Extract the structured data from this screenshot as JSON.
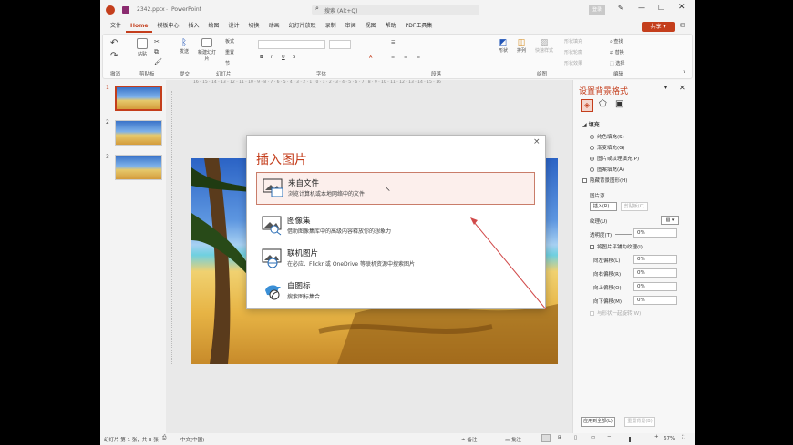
{
  "titlebar": {
    "filename": "2342.pptx",
    "app": "PowerPoint",
    "search_placeholder": "搜索 (Alt+Q)",
    "login": "登录",
    "share": "共享"
  },
  "ribbon_tabs": [
    "文件",
    "Home",
    "模板中心",
    "插入",
    "绘图",
    "设计",
    "切换",
    "动画",
    "幻灯片放映",
    "录制",
    "审阅",
    "视图",
    "帮助",
    "PDF工具集"
  ],
  "ribbon": {
    "paste": "粘贴",
    "send": "发送",
    "new_slide": "新建幻灯片",
    "layout": "板式",
    "reset": "重置",
    "section": "节",
    "shape": "形状",
    "arrange": "排列",
    "quick_styles": "快速样式",
    "shape_fill": "形状填充",
    "shape_outline": "形状轮廓",
    "shape_effect": "形状效果",
    "find": "查找",
    "replace": "替换",
    "select": "选择",
    "groups": {
      "undo": "撤消",
      "clipboard": "剪贴板",
      "present": "提交",
      "slides": "幻灯片",
      "font": "字体",
      "paragraph": "段落",
      "drawing": "绘图",
      "edit": "编辑"
    }
  },
  "thumbnails": [
    "1",
    "2",
    "3"
  ],
  "ruler_numbers": "16 · 15 · 14 · 13 · 12 · 11 · 10 · 9 · 8 · 7 · 6 · 5 · 4 · 3 · 2 · 1 · 0 · 1 · 2 · 3 · 4 · 5 · 6 · 7 · 8 · 9 · 10 · 11 · 12 · 13 · 14 · 15 · 16",
  "dialog": {
    "title": "插入图片",
    "close": "×",
    "options": [
      {
        "title": "来自文件",
        "desc": "浏览计算机或本地网络中的文件"
      },
      {
        "title": "图像集",
        "desc": "借助图像集库中的高级内容释放你的想象力"
      },
      {
        "title": "联机图片",
        "desc": "在必应、Flickr 或 OneDrive 等联机资源中搜索图片"
      },
      {
        "title": "自图标",
        "desc": "搜索图标集合"
      }
    ]
  },
  "format_pane": {
    "title": "设置背景格式",
    "section_fill": "填充",
    "fill_options": [
      "纯色填充(S)",
      "渐变填充(G)",
      "图片或纹理填充(P)",
      "图案填充(A)"
    ],
    "hide_bg": "隐藏背景图形(H)",
    "picture_source": "图片源",
    "insert_btn": "插入(R)...",
    "clipboard_btn": "剪贴板(C)",
    "texture": "纹理(U)",
    "transparency": "透明度(T)",
    "transparency_val": "0%",
    "tile": "将图片平铺为纹理(I)",
    "offsets": [
      {
        "label": "向左偏移(L)",
        "val": "0%"
      },
      {
        "label": "向右偏移(R)",
        "val": "0%"
      },
      {
        "label": "向上偏移(O)",
        "val": "0%"
      },
      {
        "label": "向下偏移(M)",
        "val": "0%"
      }
    ],
    "rotate_with": "与形状一起旋转(W)",
    "apply_all": "应用到全部(L)",
    "reset_bg": "重置背景(B)"
  },
  "statusbar": {
    "slide_info": "幻灯片 第 1 张，共 3 张",
    "language": "中文(中国)",
    "notes": "备注",
    "comments": "批注",
    "zoom": "67%"
  }
}
